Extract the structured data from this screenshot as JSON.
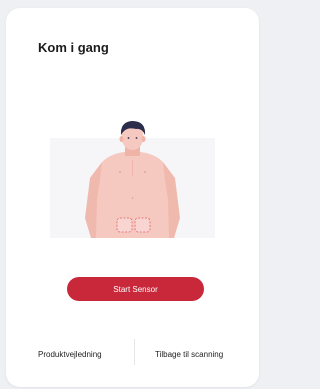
{
  "page": {
    "title": "Kom i gang"
  },
  "illustration": {
    "icon": "sensor-placement-illustration",
    "colors": {
      "skin": "#f6c9c0",
      "hair": "#2b2d4a",
      "sensor_outline": "#e0606a",
      "backdrop": "#f6f6f8"
    }
  },
  "actions": {
    "start_label": "Start Sensor",
    "start_color": "#c8283a"
  },
  "footer": {
    "guide_label": "Produktvejledning",
    "back_label": "Tilbage til scanning"
  }
}
